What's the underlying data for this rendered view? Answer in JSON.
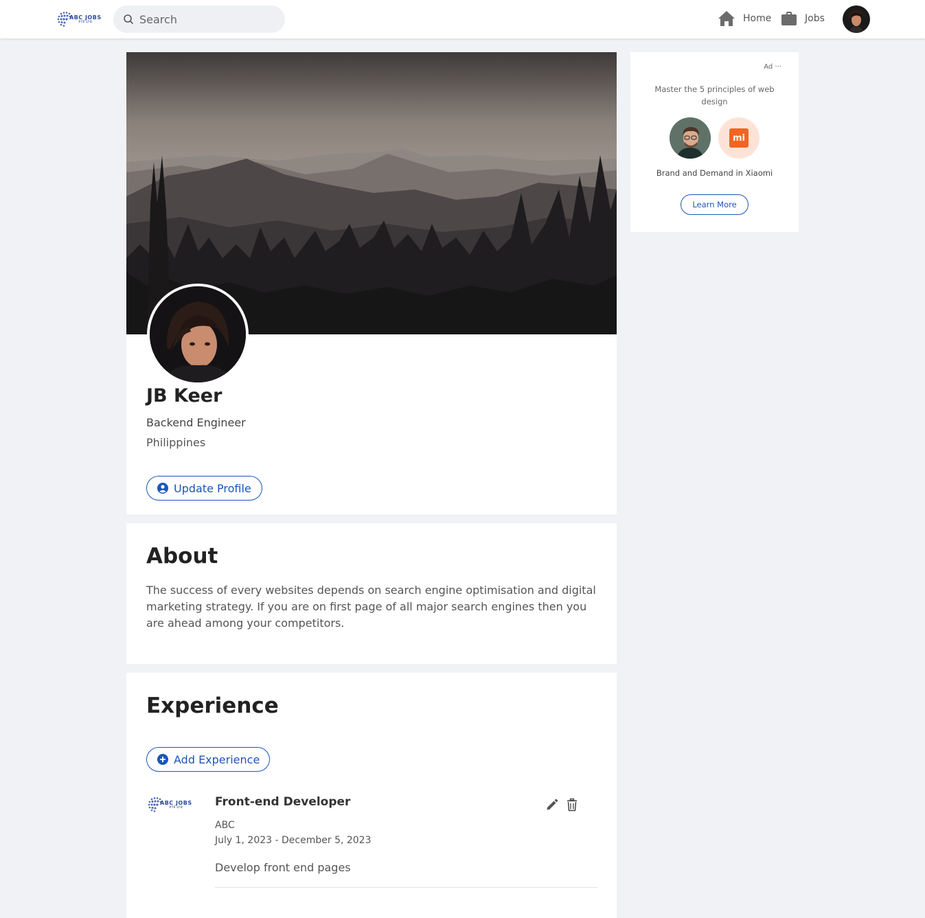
{
  "navbar": {
    "logo_text": "ABC JOBS",
    "logo_subtext": "PTE LTD",
    "search_placeholder": "Search",
    "home_label": "Home",
    "jobs_label": "Jobs",
    "brand_color": "#2d4a9a"
  },
  "profile": {
    "name": "JB Keer",
    "title": "Backend Engineer",
    "location": "Philippines",
    "update_button": "Update Profile"
  },
  "about": {
    "heading": "About",
    "text": "The success of every websites depends on search engine optimisation and digital marketing strategy. If you are on first page of all major search engines then you are ahead among your competitors."
  },
  "experience": {
    "heading": "Experience",
    "add_button": "Add Experience",
    "items": [
      {
        "logo_text": "ABC JOBS",
        "logo_subtext": "PTE LTD",
        "role": "Front-end Developer",
        "company": "ABC",
        "dates": "July 1, 2023 - December 5, 2023",
        "description": "Develop front end pages"
      }
    ]
  },
  "ad": {
    "label": "Ad",
    "more": "···",
    "headline": "Master the 5 principles of web design",
    "brand_logo_text": "mi",
    "caption": "Brand and Demand in Xiaomi",
    "button": "Learn More",
    "brand_color": "#f16522"
  },
  "colors": {
    "accent": "#1a56b8",
    "page_bg": "#f1f2f6"
  }
}
